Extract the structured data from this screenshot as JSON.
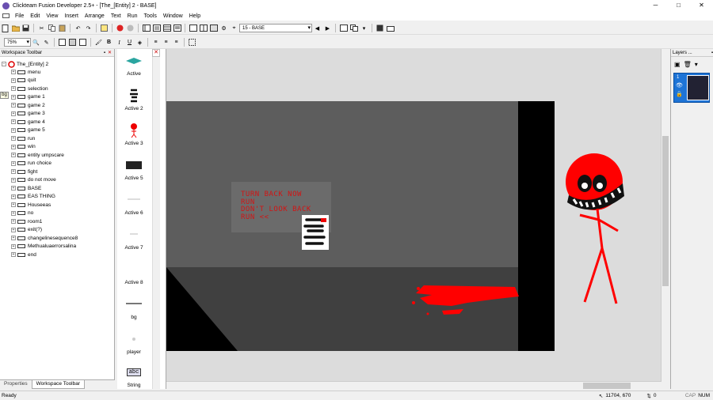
{
  "window": {
    "title": "Clickteam Fusion Developer 2.5+ - [The_[Entity] 2 - BASE]",
    "minimize": "─",
    "maximize": "□",
    "close": "✕"
  },
  "menu": [
    "File",
    "Edit",
    "View",
    "Insert",
    "Arrange",
    "Text",
    "Run",
    "Tools",
    "Window",
    "Help"
  ],
  "toolbar": {
    "frame_select": "15 - BASE",
    "zoom": "75%"
  },
  "workspace": {
    "panel_title": "Workspace Toolbar",
    "root": "The_[Entity] 2",
    "frames": [
      "menu",
      "quit",
      "selection",
      "game 1",
      "game 2",
      "game 3",
      "game 4",
      "game 5",
      "run",
      "win",
      "entity umpscare",
      "run choice",
      "fight",
      "do not move",
      "BASE",
      "EAS THING",
      "Houseeas",
      "no",
      "room1",
      "exit(?)",
      "changelinesequence8",
      "Methualuaerrorsalina",
      "end"
    ],
    "tabs": [
      "Properties",
      "Workspace Toolbar"
    ],
    "bg_label": "bg"
  },
  "objects": [
    "Active",
    "Active 2",
    "Active 3",
    "Active 5",
    "Active 6",
    "Active 7",
    "Active 8",
    "bg",
    "player",
    "String"
  ],
  "string_icon": "abc",
  "layers": {
    "panel_title": "Layers ...",
    "layer_number": "1"
  },
  "scene": {
    "text_lines": [
      "TURN BACK NOW",
      "RUN",
      "DON'T LOOK BACK",
      "RUN  <<"
    ]
  },
  "status": {
    "left": "Ready",
    "coords": "11704, 670",
    "zero": "0",
    "caps": "CAP",
    "num": "NUM"
  },
  "colors": {
    "entity_red": "#ff0000",
    "text_red": "#d21414",
    "scene_wall": "#5d5d5d",
    "scene_floor": "#404040"
  }
}
